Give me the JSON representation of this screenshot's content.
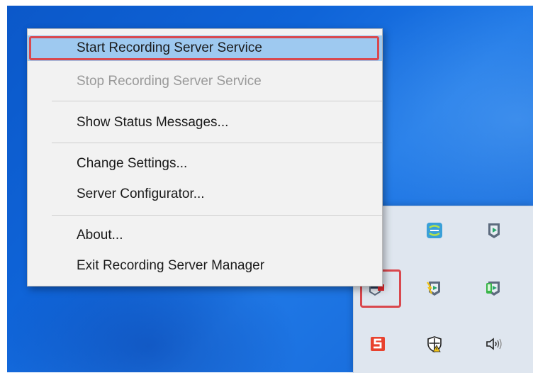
{
  "context_menu": {
    "items": [
      {
        "label": "Start Recording Server Service",
        "state": "highlighted"
      },
      {
        "label": "Stop Recording Server Service",
        "state": "disabled"
      },
      {
        "label": "Show Status Messages...",
        "state": "enabled"
      },
      {
        "label": "Change Settings...",
        "state": "enabled"
      },
      {
        "label": "Server Configurator...",
        "state": "enabled"
      },
      {
        "label": "About...",
        "state": "enabled"
      },
      {
        "label": "Exit Recording Server Manager",
        "state": "enabled"
      }
    ]
  },
  "tray_overflow": {
    "icons": [
      {
        "name": "monitor-app-icon"
      },
      {
        "name": "network-globe-icon"
      },
      {
        "name": "management-client-icon"
      },
      {
        "name": "recording-server-manager-icon",
        "status": "stopped"
      },
      {
        "name": "event-server-manager-icon"
      },
      {
        "name": "mobile-server-manager-icon"
      },
      {
        "name": "s-app-icon"
      },
      {
        "name": "security-shield-icon"
      },
      {
        "name": "volume-icon"
      }
    ]
  },
  "colors": {
    "highlight_border": "#d9484e",
    "menu_selection": "#9ec9f0",
    "desktop_blue": "#0f64d8",
    "menu_background": "#f2f2f2",
    "disabled_text": "#9a9a9a"
  }
}
